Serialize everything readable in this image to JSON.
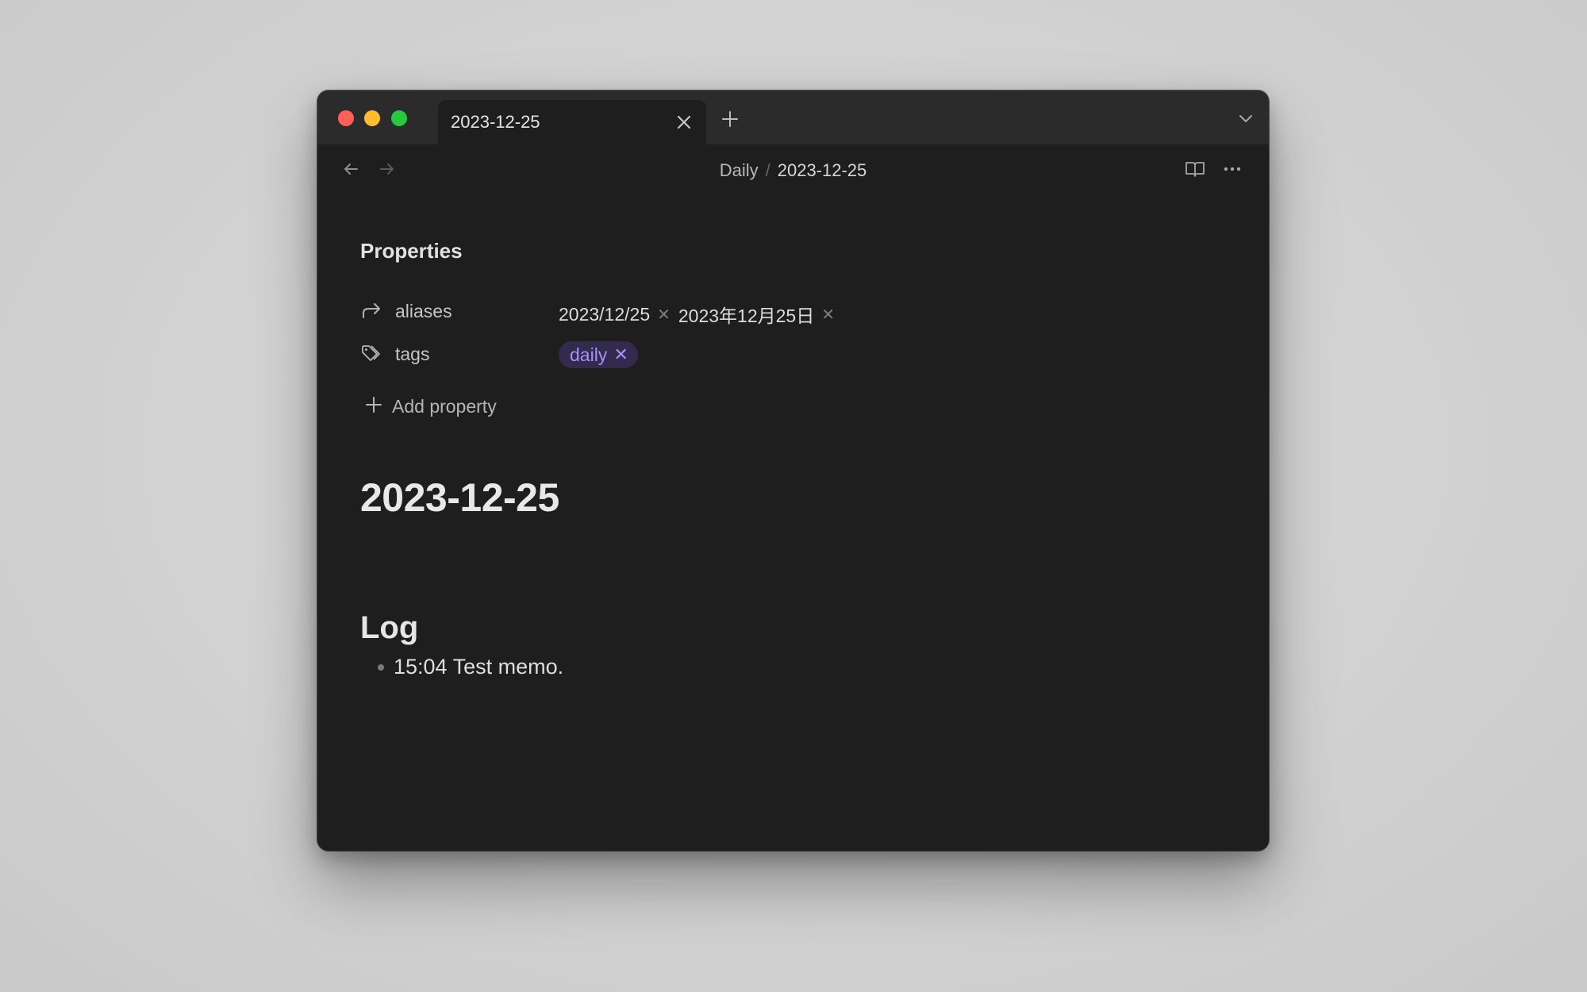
{
  "tab": {
    "title": "2023-12-25"
  },
  "breadcrumb": {
    "folder": "Daily",
    "separator": "/",
    "file": "2023-12-25"
  },
  "properties": {
    "heading": "Properties",
    "aliases": {
      "key": "aliases",
      "values": [
        "2023/12/25",
        "2023年12月25日"
      ]
    },
    "tags": {
      "key": "tags",
      "values": [
        "daily"
      ]
    },
    "add_label": "Add property"
  },
  "note": {
    "title": "2023-12-25",
    "section": "Log",
    "items": [
      "15:04 Test memo."
    ]
  },
  "colors": {
    "window_bg": "#1e1e1e",
    "titlebar_bg": "#2b2b2b",
    "tag_text": "#a88ef7",
    "tag_bg": "#332b4d"
  },
  "icons": [
    "back-arrow-icon",
    "forward-arrow-icon",
    "reading-view-icon",
    "more-options-icon",
    "aliases-icon",
    "tags-icon",
    "plus-icon",
    "close-icon",
    "chevron-down-icon"
  ]
}
